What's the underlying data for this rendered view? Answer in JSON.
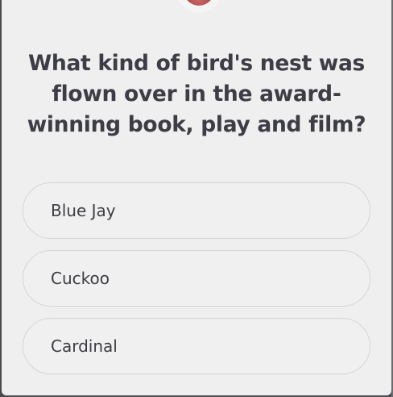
{
  "quiz": {
    "question": "What kind of bird's nest was flown over in the award-winning book, play and film?",
    "options": [
      {
        "label": "Blue Jay"
      },
      {
        "label": "Cuckoo"
      },
      {
        "label": "Cardinal"
      }
    ]
  },
  "colors": {
    "card_background": "#efefef",
    "text": "#3d3d45",
    "option_border": "#d6d6d6",
    "avatar_accent": "#a83d3d"
  },
  "icons": {
    "avatar": "avatar-icon"
  }
}
